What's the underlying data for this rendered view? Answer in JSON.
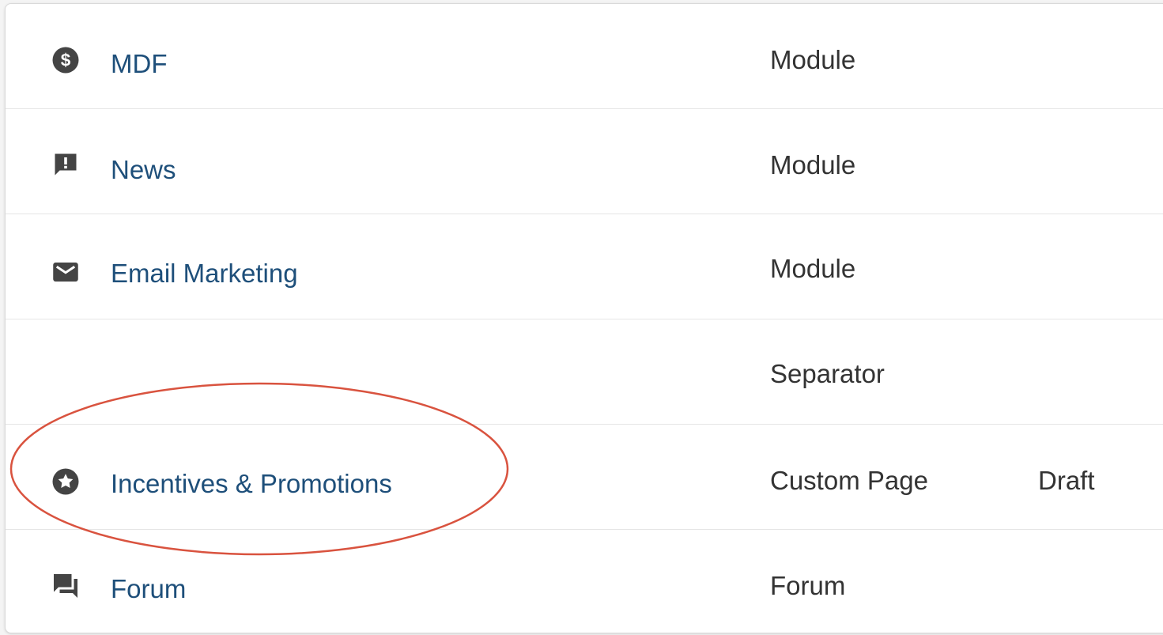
{
  "rows": [
    {
      "name": "MDF",
      "icon": "dollar-circle-icon",
      "type": "Module",
      "status": ""
    },
    {
      "name": "News",
      "icon": "alert-message-icon",
      "type": "Module",
      "status": ""
    },
    {
      "name": "Email Marketing",
      "icon": "envelope-icon",
      "type": "Module",
      "status": ""
    },
    {
      "name": "",
      "icon": "",
      "type": "Separator",
      "status": ""
    },
    {
      "name": "Incentives & Promotions",
      "icon": "star-circle-icon",
      "type": "Custom Page",
      "status": "Draft"
    },
    {
      "name": "Forum",
      "icon": "forum-chat-icon",
      "type": "Forum",
      "status": ""
    }
  ],
  "colors": {
    "link": "#1e4f7a",
    "text": "#333333",
    "icon": "#444444",
    "annotation": "#d9533f"
  }
}
